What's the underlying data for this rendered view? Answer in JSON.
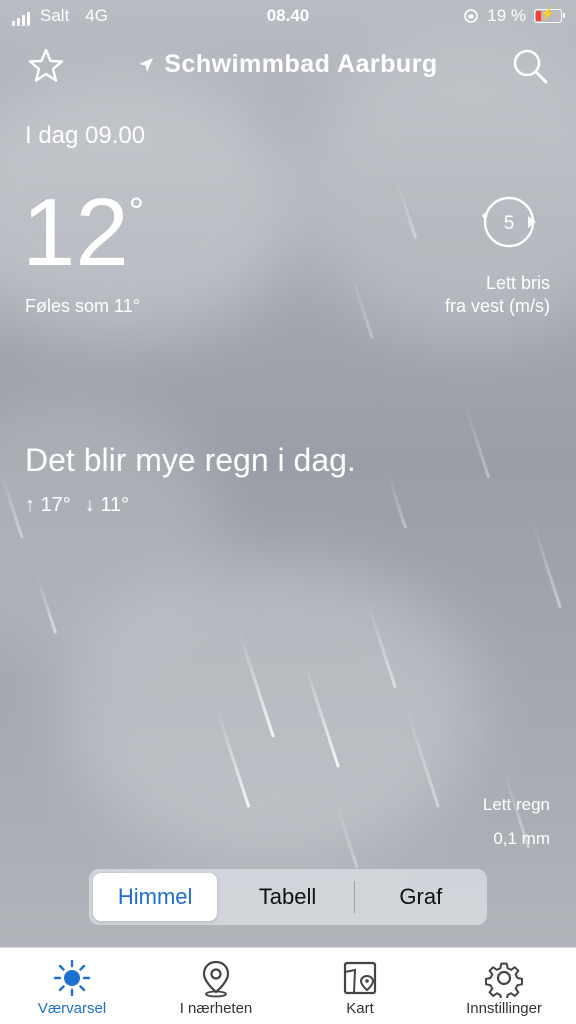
{
  "status_bar": {
    "carrier": "Salt",
    "network": "4G",
    "time": "08.40",
    "battery_percent": "19 %"
  },
  "header": {
    "location": "Schwimmbad Aarburg"
  },
  "forecast": {
    "date_time": "I dag 09.00",
    "temperature": "12",
    "degree_symbol": "°",
    "feels_like": "Føles som 11°",
    "wind_speed": "5",
    "wind_line1": "Lett bris",
    "wind_line2": "fra vest (m/s)",
    "summary": "Det blir mye regn i dag.",
    "max_temp": "17°",
    "min_temp": "11°",
    "precip_label": "Lett regn",
    "precip_amount": "0,1 mm"
  },
  "segments": {
    "items": [
      "Himmel",
      "Tabell",
      "Graf"
    ],
    "selected": "Himmel"
  },
  "tabbar": {
    "items": [
      {
        "label": "Værvarsel",
        "icon": "sun-icon",
        "active": true
      },
      {
        "label": "I nærheten",
        "icon": "map-pin-icon",
        "active": false
      },
      {
        "label": "Kart",
        "icon": "map-icon",
        "active": false
      },
      {
        "label": "Innstillinger",
        "icon": "gear-icon",
        "active": false
      }
    ]
  },
  "colors": {
    "accent": "#1f6fd1",
    "battery_low": "#ff3b30"
  }
}
